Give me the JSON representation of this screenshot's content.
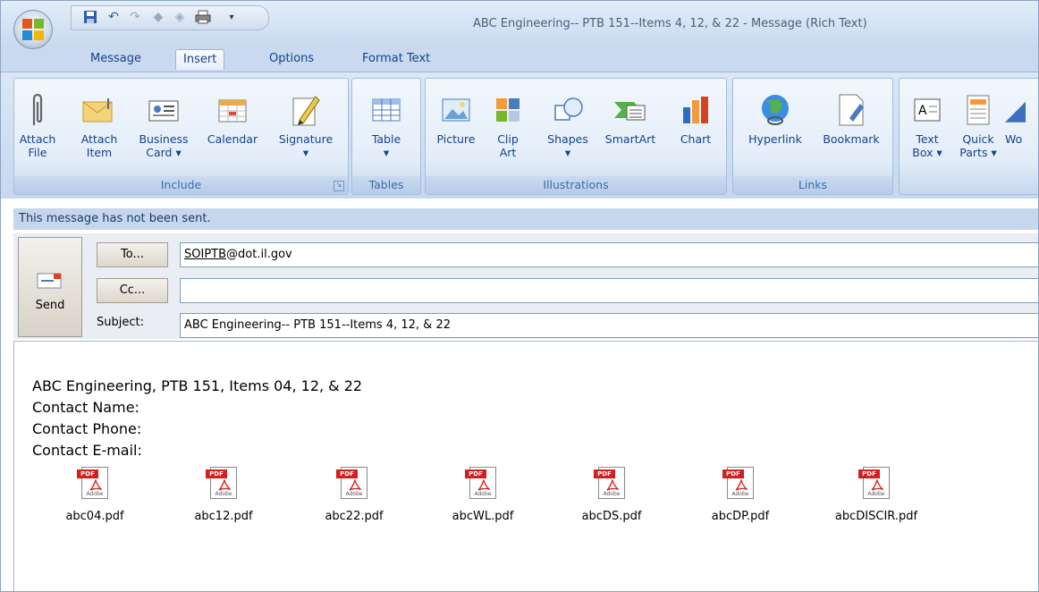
{
  "window": {
    "title": "ABC Engineering-- PTB 151--Items 4, 12, & 22 - Message (Rich Text)"
  },
  "qat": {
    "icons": [
      "save-icon",
      "undo-icon",
      "redo-icon",
      "up-arrow-icon",
      "down-arrow-icon",
      "print-icon",
      "customize-icon"
    ]
  },
  "tabs": [
    {
      "label": "Message"
    },
    {
      "label": "Insert"
    },
    {
      "label": "Options"
    },
    {
      "label": "Format Text"
    }
  ],
  "ribbon": {
    "include": {
      "label": "Include",
      "buttons": [
        {
          "label1": "Attach",
          "label2": "File"
        },
        {
          "label1": "Attach",
          "label2": "Item"
        },
        {
          "label1": "Business",
          "label2": "Card ▾"
        },
        {
          "label1": "Calendar",
          "label2": ""
        },
        {
          "label1": "Signature",
          "label2": "▾"
        }
      ]
    },
    "tables": {
      "label": "Tables",
      "buttons": [
        {
          "label1": "Table",
          "label2": "▾"
        }
      ]
    },
    "illustrations": {
      "label": "Illustrations",
      "buttons": [
        {
          "label1": "Picture",
          "label2": ""
        },
        {
          "label1": "Clip",
          "label2": "Art"
        },
        {
          "label1": "Shapes",
          "label2": "▾"
        },
        {
          "label1": "SmartArt",
          "label2": ""
        },
        {
          "label1": "Chart",
          "label2": ""
        }
      ]
    },
    "links": {
      "label": "Links",
      "buttons": [
        {
          "label1": "Hyperlink",
          "label2": ""
        },
        {
          "label1": "Bookmark",
          "label2": ""
        }
      ]
    },
    "text": {
      "buttons": [
        {
          "label1": "Text",
          "label2": "Box ▾"
        },
        {
          "label1": "Quick",
          "label2": "Parts ▾"
        },
        {
          "label1": "Wo",
          "label2": ""
        }
      ]
    }
  },
  "infobar": {
    "text": "This message has not been sent."
  },
  "header": {
    "send_label": "Send",
    "to_label": "To...",
    "cc_label": "Cc...",
    "subject_label": "Subject:",
    "to_value_user": "SOIPTB",
    "to_value_domain": "@dot.il.gov",
    "cc_value": "",
    "subject_value": "ABC Engineering-- PTB 151--Items 4, 12, & 22"
  },
  "body": {
    "lines": [
      "ABC Engineering, PTB 151, Items 04, 12, & 22",
      "Contact Name:",
      "Contact Phone:",
      "Contact E-mail:"
    ],
    "pdf_badge": "PDF",
    "pdf_brand": "Adobe",
    "attachments": [
      "abc04.pdf",
      "abc12.pdf",
      "abc22.pdf",
      "abcWL.pdf",
      "abcDS.pdf",
      "abcDP.pdf",
      "abcDISCIR.pdf"
    ]
  }
}
